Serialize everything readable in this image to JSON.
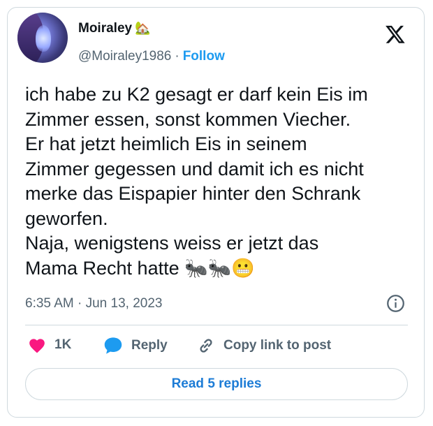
{
  "author": {
    "display_name": "Moiraley",
    "name_emoji": "🏡",
    "handle": "@Moiraley1986",
    "separator": "·",
    "follow_label": "Follow"
  },
  "tweet": {
    "text": "ich habe zu K2 gesagt er darf kein Eis im\nZimmer essen, sonst kommen Viecher.\nEr hat jetzt heimlich Eis in seinem\nZimmer gegessen und damit ich es nicht\nmerke das Eispapier hinter den Schrank\ngeworfen.\nNaja, wenigstens weiss er jetzt das\nMama Recht hatte 🐜🐜😬",
    "timestamp": "6:35 AM · Jun 13, 2023"
  },
  "actions": {
    "like_count": "1K",
    "reply_label": "Reply",
    "copy_label": "Copy link to post"
  },
  "footer": {
    "read_replies_label": "Read 5 replies"
  },
  "colors": {
    "accent": "#1d9bf0",
    "like": "#f91880",
    "text": "#0f1419",
    "muted": "#536471",
    "border": "#cfd9de"
  },
  "icons": [
    "x-logo-icon",
    "info-icon",
    "heart-icon",
    "speech-bubble-icon",
    "link-icon"
  ]
}
